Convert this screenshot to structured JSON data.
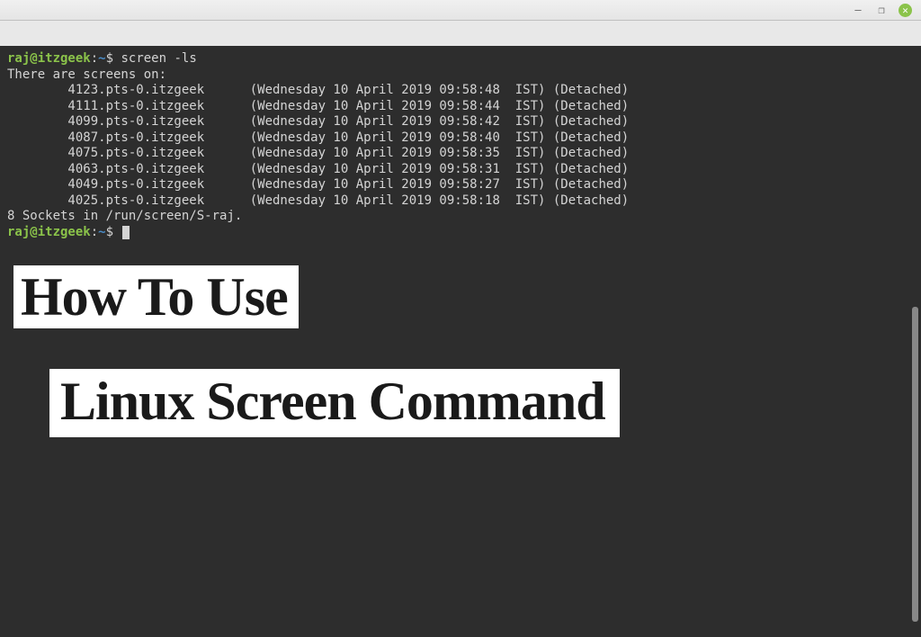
{
  "prompt": {
    "user_host": "raj@itzgeek",
    "separator": ":",
    "path": "~",
    "symbol": "$"
  },
  "command": "screen -ls",
  "output": {
    "header": "There are screens on:",
    "sessions": [
      {
        "id": "4123.pts-0.itzgeek",
        "date": "(Wednesday 10 April 2019 09:58:48  IST)",
        "state": "(Detached)"
      },
      {
        "id": "4111.pts-0.itzgeek",
        "date": "(Wednesday 10 April 2019 09:58:44  IST)",
        "state": "(Detached)"
      },
      {
        "id": "4099.pts-0.itzgeek",
        "date": "(Wednesday 10 April 2019 09:58:42  IST)",
        "state": "(Detached)"
      },
      {
        "id": "4087.pts-0.itzgeek",
        "date": "(Wednesday 10 April 2019 09:58:40  IST)",
        "state": "(Detached)"
      },
      {
        "id": "4075.pts-0.itzgeek",
        "date": "(Wednesday 10 April 2019 09:58:35  IST)",
        "state": "(Detached)"
      },
      {
        "id": "4063.pts-0.itzgeek",
        "date": "(Wednesday 10 April 2019 09:58:31  IST)",
        "state": "(Detached)"
      },
      {
        "id": "4049.pts-0.itzgeek",
        "date": "(Wednesday 10 April 2019 09:58:27  IST)",
        "state": "(Detached)"
      },
      {
        "id": "4025.pts-0.itzgeek",
        "date": "(Wednesday 10 April 2019 09:58:18  IST)",
        "state": "(Detached)"
      }
    ],
    "footer": "8 Sockets in /run/screen/S-raj."
  },
  "window_controls": {
    "minimize": "–",
    "maximize": "❐",
    "close": "✕"
  },
  "overlay": {
    "line1": "How To Use",
    "line2": "Linux Screen Command"
  }
}
